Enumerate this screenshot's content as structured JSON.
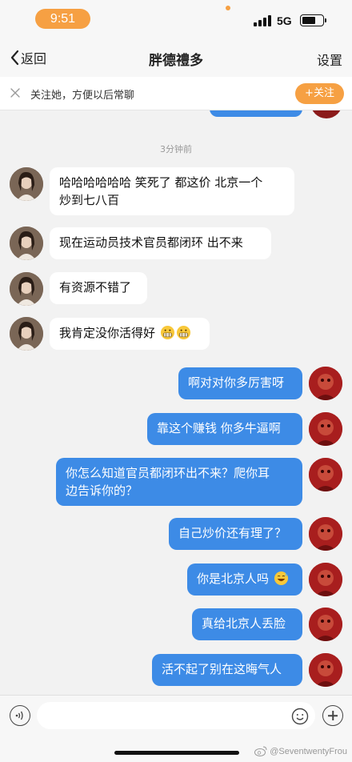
{
  "status_bar": {
    "time": "9:51",
    "network": "5G",
    "battery_level": 0.65
  },
  "nav": {
    "back_label": "返回",
    "title": "胖德禮多",
    "settings_label": "设置"
  },
  "follow_bar": {
    "text": "关注她，方便以后常聊",
    "button_label": "+关注"
  },
  "timestamp": "3分钟前",
  "messages": [
    {
      "side": "left",
      "lines": [
        "哈哈哈哈哈哈 笑死了 都这价 北京一个",
        "炒到七八百"
      ]
    },
    {
      "side": "left",
      "text": "现在运动员技术官员都闭环 出不来"
    },
    {
      "side": "left",
      "text": "有资源不错了"
    },
    {
      "side": "left",
      "text": "我肯定没你活得好",
      "emojis": [
        "grimacing-emoji",
        "grimacing-emoji"
      ]
    },
    {
      "side": "right",
      "text": "啊对对你多厉害呀"
    },
    {
      "side": "right",
      "text": "靠这个赚钱 你多牛逼啊"
    },
    {
      "side": "right",
      "lines": [
        "你怎么知道官员都闭环出不来？爬你耳",
        "边告诉你的？"
      ]
    },
    {
      "side": "right",
      "text": "自己炒价还有理了？"
    },
    {
      "side": "right",
      "text": "你是北京人吗",
      "emojis": [
        "sweat-smile-emoji"
      ]
    },
    {
      "side": "right",
      "text": "真给北京人丢脸"
    },
    {
      "side": "right",
      "text": "活不起了别在这晦气人"
    }
  ],
  "input": {
    "placeholder": ""
  },
  "watermark": "@SeventwentyFrou",
  "colors": {
    "accent": "#f6a043",
    "outgoing_bubble": "#3d8be6",
    "incoming_bubble": "#ffffff",
    "background": "#f2f2f2"
  },
  "icons": [
    "back-chevron-icon",
    "close-icon",
    "voice-icon",
    "smile-icon",
    "plus-icon",
    "weibo-icon"
  ]
}
